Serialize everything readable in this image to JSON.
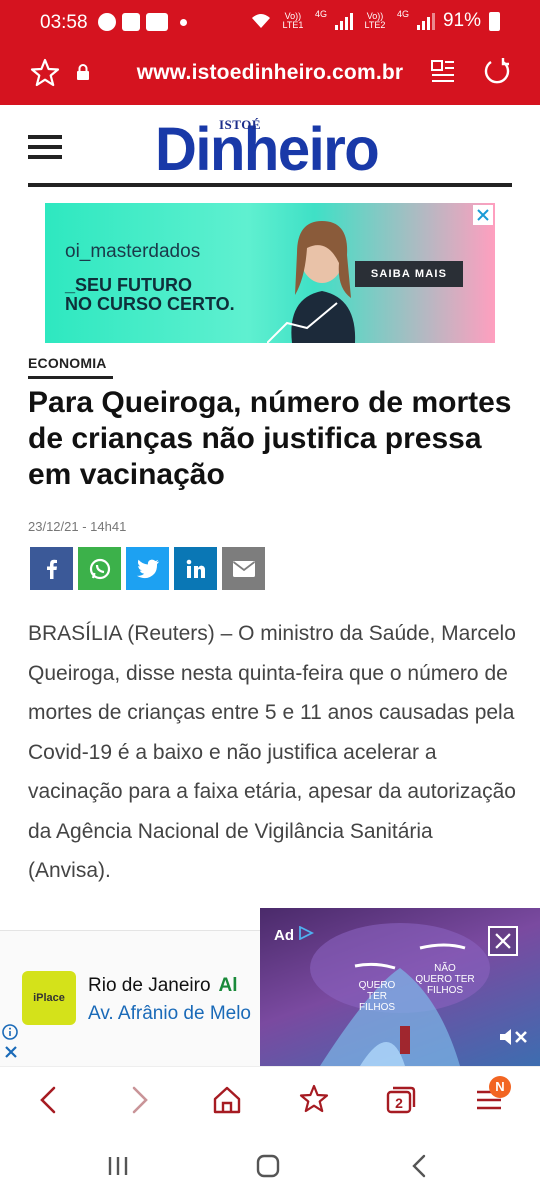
{
  "status_bar": {
    "time": "03:58",
    "net1": "Vo)) LTE1",
    "net1_type": "4G",
    "net2": "Vo)) LTE2",
    "net2_type": "4G",
    "battery": "91%"
  },
  "browser": {
    "url": "www.istoedinheiro.com.br",
    "tab_count": "2",
    "notification_badge": "N",
    "accent_color": "#d5131f"
  },
  "site": {
    "logo_small": "ISTOÉ",
    "logo_name": "Dinheiro"
  },
  "top_ad": {
    "brand": "oi_masterdados",
    "slogan_line1": "_SEU FUTURO",
    "slogan_line2": "NO CURSO CERTO.",
    "cta": "SAIBA MAIS"
  },
  "article": {
    "category": "ECONOMIA",
    "headline": "Para Queiroga, número de mortes de crianças não justifica pressa em vacinação",
    "dateline": "23/12/21 - 14h41",
    "body": "BRASÍLIA (Reuters) – O ministro da Saúde, Marcelo Queiroga, disse nesta quinta-feira que o número de mortes de crianças entre 5 e 11 anos causadas pela Covid-19 é a baixo e não justifica acelerar a vacinação para a faixa etária, apesar da autorização da Agência Nacional de Vigilância Sanitária (Anvisa)."
  },
  "share_buttons": [
    {
      "network": "facebook",
      "color": "#3b5998",
      "glyph": "f"
    },
    {
      "network": "whatsapp",
      "color": "#3cb14a",
      "glyph": "whatsapp-icon"
    },
    {
      "network": "twitter",
      "color": "#1da1f2",
      "glyph": "twitter-icon"
    },
    {
      "network": "linkedin",
      "color": "#0a77b5",
      "glyph": "in"
    },
    {
      "network": "email",
      "color": "#7d7d7d",
      "glyph": "envelope-icon"
    }
  ],
  "bottom_ad": {
    "logo_text": "iPlace",
    "line1": "Rio de Janeiro",
    "line1_suffix": "Al",
    "line2": "Av. Afrânio de Melo"
  },
  "video_ad": {
    "label": "Ad",
    "option1": "QUERO TER FILHOS",
    "option2": "NÃO QUERO TER FILHOS"
  }
}
